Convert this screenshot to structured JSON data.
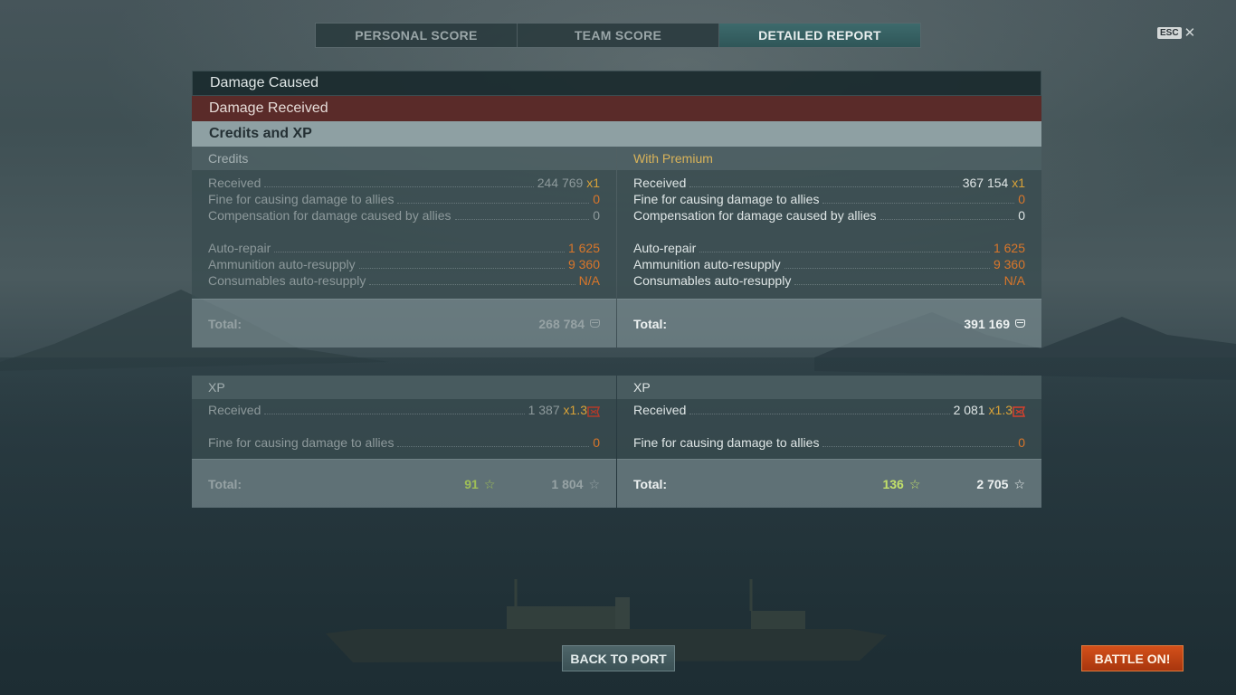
{
  "tabs": [
    {
      "label": "PERSONAL SCORE"
    },
    {
      "label": "TEAM SCORE"
    },
    {
      "label": "DETAILED REPORT"
    }
  ],
  "esc": {
    "key": "ESC",
    "close": "✕"
  },
  "sections": {
    "damage_caused": "Damage Caused",
    "damage_received": "Damage Received",
    "credits_xp": "Credits and XP"
  },
  "credits": {
    "title": "Credits",
    "received_label": "Received",
    "received_value": "244 769",
    "received_mult": "x1",
    "fine_label": "Fine for causing damage to allies",
    "fine_value": "0",
    "comp_label": "Compensation for damage caused by allies",
    "comp_value": "0",
    "repair_label": "Auto-repair",
    "repair_value": "1 625",
    "ammo_label": "Ammunition auto-resupply",
    "ammo_value": "9 360",
    "cons_label": "Consumables auto-resupply",
    "cons_value": "N/A",
    "total_label": "Total:",
    "total_value": "268 784"
  },
  "premium": {
    "title": "With Premium",
    "received_label": "Received",
    "received_value": "367 154",
    "received_mult": "x1",
    "fine_label": "Fine for causing damage to allies",
    "fine_value": "0",
    "comp_label": "Compensation for damage caused by allies",
    "comp_value": "0",
    "repair_label": "Auto-repair",
    "repair_value": "1 625",
    "ammo_label": "Ammunition auto-resupply",
    "ammo_value": "9 360",
    "cons_label": "Consumables auto-resupply",
    "cons_value": "N/A",
    "total_label": "Total:",
    "total_value": "391 169"
  },
  "xp_left": {
    "title": "XP",
    "received_label": "Received",
    "received_value": "1 387",
    "received_mult": "x1.3",
    "fine_label": "Fine for causing damage to allies",
    "fine_value": "0",
    "total_label": "Total:",
    "free_xp": "91",
    "xp_total": "1 804"
  },
  "xp_right": {
    "title": "XP",
    "received_label": "Received",
    "received_value": "2 081",
    "received_mult": "x1.3",
    "fine_label": "Fine for causing damage to allies",
    "fine_value": "0",
    "total_label": "Total:",
    "free_xp": "136",
    "xp_total": "2 705"
  },
  "buttons": {
    "back": "BACK TO PORT",
    "battle": "BATTLE ON!"
  },
  "icons": {
    "star": "☆",
    "credit": "credit-icon",
    "xp_flag": "xp-flag-icon"
  },
  "colors": {
    "accent_orange": "#d9762a",
    "premium_gold": "#d9b35a",
    "free_xp_green": "#9fbf57",
    "battle_button": "#c44616",
    "active_tab": "#3d6a6c",
    "damage_received_bg": "#5a2b29"
  }
}
